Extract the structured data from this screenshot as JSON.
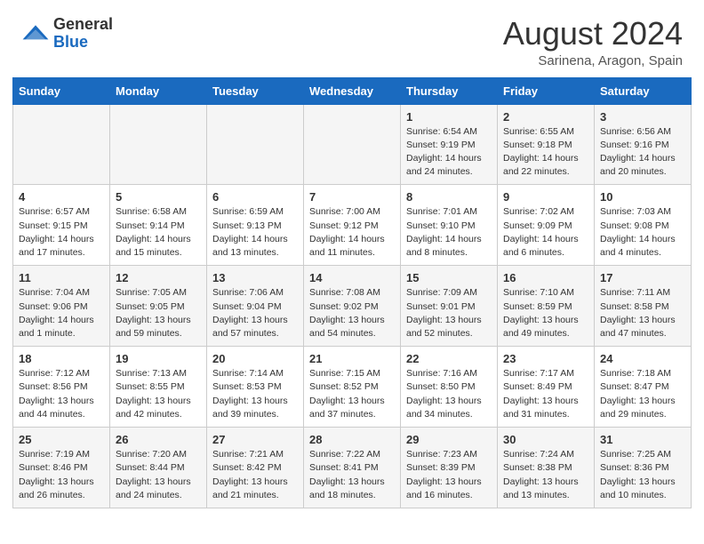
{
  "header": {
    "logo_general": "General",
    "logo_blue": "Blue",
    "month_year": "August 2024",
    "location": "Sarinena, Aragon, Spain"
  },
  "weekdays": [
    "Sunday",
    "Monday",
    "Tuesday",
    "Wednesday",
    "Thursday",
    "Friday",
    "Saturday"
  ],
  "weeks": [
    [
      {
        "day": "",
        "sunrise": "",
        "sunset": "",
        "daylight": ""
      },
      {
        "day": "",
        "sunrise": "",
        "sunset": "",
        "daylight": ""
      },
      {
        "day": "",
        "sunrise": "",
        "sunset": "",
        "daylight": ""
      },
      {
        "day": "",
        "sunrise": "",
        "sunset": "",
        "daylight": ""
      },
      {
        "day": "1",
        "sunrise": "Sunrise: 6:54 AM",
        "sunset": "Sunset: 9:19 PM",
        "daylight": "Daylight: 14 hours and 24 minutes."
      },
      {
        "day": "2",
        "sunrise": "Sunrise: 6:55 AM",
        "sunset": "Sunset: 9:18 PM",
        "daylight": "Daylight: 14 hours and 22 minutes."
      },
      {
        "day": "3",
        "sunrise": "Sunrise: 6:56 AM",
        "sunset": "Sunset: 9:16 PM",
        "daylight": "Daylight: 14 hours and 20 minutes."
      }
    ],
    [
      {
        "day": "4",
        "sunrise": "Sunrise: 6:57 AM",
        "sunset": "Sunset: 9:15 PM",
        "daylight": "Daylight: 14 hours and 17 minutes."
      },
      {
        "day": "5",
        "sunrise": "Sunrise: 6:58 AM",
        "sunset": "Sunset: 9:14 PM",
        "daylight": "Daylight: 14 hours and 15 minutes."
      },
      {
        "day": "6",
        "sunrise": "Sunrise: 6:59 AM",
        "sunset": "Sunset: 9:13 PM",
        "daylight": "Daylight: 14 hours and 13 minutes."
      },
      {
        "day": "7",
        "sunrise": "Sunrise: 7:00 AM",
        "sunset": "Sunset: 9:12 PM",
        "daylight": "Daylight: 14 hours and 11 minutes."
      },
      {
        "day": "8",
        "sunrise": "Sunrise: 7:01 AM",
        "sunset": "Sunset: 9:10 PM",
        "daylight": "Daylight: 14 hours and 8 minutes."
      },
      {
        "day": "9",
        "sunrise": "Sunrise: 7:02 AM",
        "sunset": "Sunset: 9:09 PM",
        "daylight": "Daylight: 14 hours and 6 minutes."
      },
      {
        "day": "10",
        "sunrise": "Sunrise: 7:03 AM",
        "sunset": "Sunset: 9:08 PM",
        "daylight": "Daylight: 14 hours and 4 minutes."
      }
    ],
    [
      {
        "day": "11",
        "sunrise": "Sunrise: 7:04 AM",
        "sunset": "Sunset: 9:06 PM",
        "daylight": "Daylight: 14 hours and 1 minute."
      },
      {
        "day": "12",
        "sunrise": "Sunrise: 7:05 AM",
        "sunset": "Sunset: 9:05 PM",
        "daylight": "Daylight: 13 hours and 59 minutes."
      },
      {
        "day": "13",
        "sunrise": "Sunrise: 7:06 AM",
        "sunset": "Sunset: 9:04 PM",
        "daylight": "Daylight: 13 hours and 57 minutes."
      },
      {
        "day": "14",
        "sunrise": "Sunrise: 7:08 AM",
        "sunset": "Sunset: 9:02 PM",
        "daylight": "Daylight: 13 hours and 54 minutes."
      },
      {
        "day": "15",
        "sunrise": "Sunrise: 7:09 AM",
        "sunset": "Sunset: 9:01 PM",
        "daylight": "Daylight: 13 hours and 52 minutes."
      },
      {
        "day": "16",
        "sunrise": "Sunrise: 7:10 AM",
        "sunset": "Sunset: 8:59 PM",
        "daylight": "Daylight: 13 hours and 49 minutes."
      },
      {
        "day": "17",
        "sunrise": "Sunrise: 7:11 AM",
        "sunset": "Sunset: 8:58 PM",
        "daylight": "Daylight: 13 hours and 47 minutes."
      }
    ],
    [
      {
        "day": "18",
        "sunrise": "Sunrise: 7:12 AM",
        "sunset": "Sunset: 8:56 PM",
        "daylight": "Daylight: 13 hours and 44 minutes."
      },
      {
        "day": "19",
        "sunrise": "Sunrise: 7:13 AM",
        "sunset": "Sunset: 8:55 PM",
        "daylight": "Daylight: 13 hours and 42 minutes."
      },
      {
        "day": "20",
        "sunrise": "Sunrise: 7:14 AM",
        "sunset": "Sunset: 8:53 PM",
        "daylight": "Daylight: 13 hours and 39 minutes."
      },
      {
        "day": "21",
        "sunrise": "Sunrise: 7:15 AM",
        "sunset": "Sunset: 8:52 PM",
        "daylight": "Daylight: 13 hours and 37 minutes."
      },
      {
        "day": "22",
        "sunrise": "Sunrise: 7:16 AM",
        "sunset": "Sunset: 8:50 PM",
        "daylight": "Daylight: 13 hours and 34 minutes."
      },
      {
        "day": "23",
        "sunrise": "Sunrise: 7:17 AM",
        "sunset": "Sunset: 8:49 PM",
        "daylight": "Daylight: 13 hours and 31 minutes."
      },
      {
        "day": "24",
        "sunrise": "Sunrise: 7:18 AM",
        "sunset": "Sunset: 8:47 PM",
        "daylight": "Daylight: 13 hours and 29 minutes."
      }
    ],
    [
      {
        "day": "25",
        "sunrise": "Sunrise: 7:19 AM",
        "sunset": "Sunset: 8:46 PM",
        "daylight": "Daylight: 13 hours and 26 minutes."
      },
      {
        "day": "26",
        "sunrise": "Sunrise: 7:20 AM",
        "sunset": "Sunset: 8:44 PM",
        "daylight": "Daylight: 13 hours and 24 minutes."
      },
      {
        "day": "27",
        "sunrise": "Sunrise: 7:21 AM",
        "sunset": "Sunset: 8:42 PM",
        "daylight": "Daylight: 13 hours and 21 minutes."
      },
      {
        "day": "28",
        "sunrise": "Sunrise: 7:22 AM",
        "sunset": "Sunset: 8:41 PM",
        "daylight": "Daylight: 13 hours and 18 minutes."
      },
      {
        "day": "29",
        "sunrise": "Sunrise: 7:23 AM",
        "sunset": "Sunset: 8:39 PM",
        "daylight": "Daylight: 13 hours and 16 minutes."
      },
      {
        "day": "30",
        "sunrise": "Sunrise: 7:24 AM",
        "sunset": "Sunset: 8:38 PM",
        "daylight": "Daylight: 13 hours and 13 minutes."
      },
      {
        "day": "31",
        "sunrise": "Sunrise: 7:25 AM",
        "sunset": "Sunset: 8:36 PM",
        "daylight": "Daylight: 13 hours and 10 minutes."
      }
    ]
  ]
}
